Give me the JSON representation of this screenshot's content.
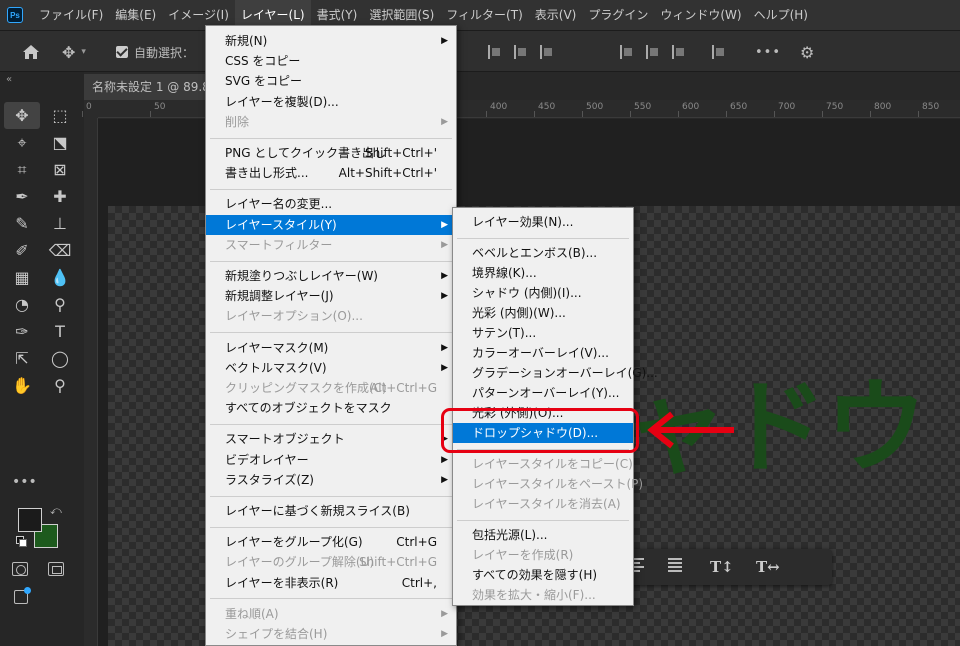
{
  "app": {
    "logo": "Ps",
    "menubar": [
      "ファイル(F)",
      "編集(E)",
      "イメージ(I)",
      "レイヤー(L)",
      "書式(Y)",
      "選択範囲(S)",
      "フィルター(T)",
      "表示(V)",
      "プラグイン",
      "ウィンドウ(W)",
      "ヘルプ(H)"
    ],
    "active_menu_index": 3
  },
  "options": {
    "auto_select_label": "自動選択：",
    "more_label": "•••"
  },
  "toolbar": {
    "collapse_label": "«",
    "more_label": "•••",
    "tools": [
      "✥",
      "⬚",
      "⌖",
      "⬔",
      "⌗",
      "⊠",
      "✒",
      "✚",
      "✎",
      "⊥",
      "✐",
      "⌫",
      "▦",
      "💧",
      "◔",
      "⚲",
      "✑",
      "T",
      "⇱",
      "◯",
      "✋",
      "⚲"
    ],
    "selected_tool_index": 0,
    "fg_color": "#1b1b1b",
    "bg_color": "#1d5a1d"
  },
  "document": {
    "tab_title": "名称未設定 1 @ 89.8",
    "ruler_labels": [
      "0",
      "50",
      "400",
      "450",
      "500",
      "550",
      "600",
      "650",
      "700",
      "750",
      "800",
      "850"
    ],
    "canvas_text": "シャドウ",
    "canvas_text_color": "#1a4b1a"
  },
  "layer_menu": [
    {
      "label": "新規(N)",
      "submenu": true
    },
    {
      "label": "CSS をコピー"
    },
    {
      "label": "SVG をコピー"
    },
    {
      "label": "レイヤーを複製(D)..."
    },
    {
      "label": "削除",
      "disabled": true,
      "submenu": true
    },
    {
      "sep": true
    },
    {
      "label": "PNG としてクイック書き出し",
      "shortcut": "Shift+Ctrl+'"
    },
    {
      "label": "書き出し形式...",
      "shortcut": "Alt+Shift+Ctrl+'"
    },
    {
      "sep": true
    },
    {
      "label": "レイヤー名の変更..."
    },
    {
      "label": "レイヤースタイル(Y)",
      "submenu": true,
      "highlight": true
    },
    {
      "label": "スマートフィルター",
      "disabled": true,
      "submenu": true
    },
    {
      "sep": true
    },
    {
      "label": "新規塗りつぶしレイヤー(W)",
      "submenu": true
    },
    {
      "label": "新規調整レイヤー(J)",
      "submenu": true
    },
    {
      "label": "レイヤーオプション(O)...",
      "disabled": true
    },
    {
      "sep": true
    },
    {
      "label": "レイヤーマスク(M)",
      "submenu": true
    },
    {
      "label": "ベクトルマスク(V)",
      "submenu": true
    },
    {
      "label": "クリッピングマスクを作成(C)",
      "shortcut": "Alt+Ctrl+G",
      "disabled": true
    },
    {
      "label": "すべてのオブジェクトをマスク"
    },
    {
      "sep": true
    },
    {
      "label": "スマートオブジェクト",
      "submenu": true
    },
    {
      "label": "ビデオレイヤー",
      "submenu": true
    },
    {
      "label": "ラスタライズ(Z)",
      "submenu": true
    },
    {
      "sep": true
    },
    {
      "label": "レイヤーに基づく新規スライス(B)"
    },
    {
      "sep": true
    },
    {
      "label": "レイヤーをグループ化(G)",
      "shortcut": "Ctrl+G"
    },
    {
      "label": "レイヤーのグループ解除(U)",
      "shortcut": "Shift+Ctrl+G",
      "disabled": true
    },
    {
      "label": "レイヤーを非表示(R)",
      "shortcut": "Ctrl+,"
    },
    {
      "sep": true
    },
    {
      "label": "重ね順(A)",
      "disabled": true,
      "submenu": true
    },
    {
      "label": "シェイプを結合(H)",
      "disabled": true,
      "submenu": true
    }
  ],
  "style_submenu": [
    {
      "label": "レイヤー効果(N)..."
    },
    {
      "sep": true
    },
    {
      "label": "ベベルとエンボス(B)..."
    },
    {
      "label": "境界線(K)..."
    },
    {
      "label": "シャドウ (内側)(I)..."
    },
    {
      "label": "光彩 (内側)(W)..."
    },
    {
      "label": "サテン(T)..."
    },
    {
      "label": "カラーオーバーレイ(V)..."
    },
    {
      "label": "グラデーションオーバーレイ(G)..."
    },
    {
      "label": "パターンオーバーレイ(Y)..."
    },
    {
      "label": "光彩 (外側)(O)..."
    },
    {
      "label": "ドロップシャドウ(D)...",
      "highlight": true
    },
    {
      "sep": true
    },
    {
      "label": "レイヤースタイルをコピー(C)",
      "disabled": true
    },
    {
      "label": "レイヤースタイルをペースト(P)",
      "disabled": true
    },
    {
      "label": "レイヤースタイルを消去(A)",
      "disabled": true
    },
    {
      "sep": true
    },
    {
      "label": "包括光源(L)..."
    },
    {
      "label": "レイヤーを作成(R)",
      "disabled": true
    },
    {
      "label": "すべての効果を隠す(H)"
    },
    {
      "label": "効果を拡大・縮小(F)...",
      "disabled": true
    }
  ],
  "annotation": {
    "color": "#e60012"
  }
}
